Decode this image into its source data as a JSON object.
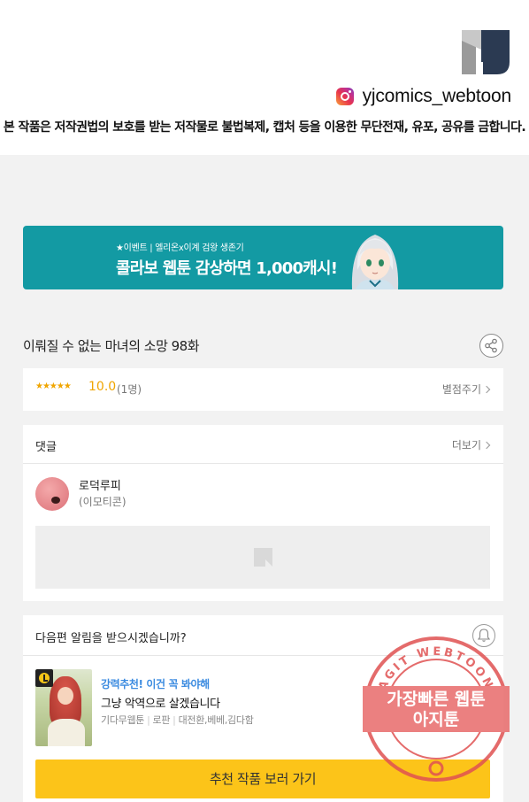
{
  "header": {
    "instagram_handle": "yjcomics_webtoon",
    "copyright_notice": "본 작품은 저작권법의 보호를 받는 저작물로 불법복제, 캡처 등을 이용한 무단전재, 유포, 공유를 금합니다."
  },
  "banner": {
    "subtitle": "★이벤트 | 엘리온x이계 검왕 생존기",
    "title": "콜라보 웹툰 감상하면 1,000캐시!"
  },
  "episode": {
    "title": "이뤄질 수 없는 마녀의 소망 98화"
  },
  "rating": {
    "stars": "★★★★★",
    "score": "10.0",
    "raters": "(1명)",
    "rate_link": "별점주기"
  },
  "comments": {
    "title": "댓글",
    "more_link": "더보기",
    "items": [
      {
        "user": "로덕루피",
        "text": "(이모티콘)"
      }
    ]
  },
  "next_episode": {
    "prompt": "다음편 알림을 받으시겠습니까?",
    "recommend_tag": "강력추천! 이건 꼭 봐야해",
    "recommend_title": "그냥 악역으로 살겠습니다",
    "meta": [
      "기다무웹툰",
      "로판",
      "대전환,베베,김다함"
    ],
    "button_label": "추천 작품 보러 가기"
  },
  "watermark": {
    "ring_text": "AGIT WEBTOON",
    "line1": "가장빠른 웹툰",
    "line2": "아지툰"
  },
  "colors": {
    "banner_bg": "#139aa3",
    "rating_accent": "#f0a500",
    "recommend_tag": "#3b8be0",
    "button_bg": "#fcc419",
    "watermark": "#e03a3a"
  }
}
